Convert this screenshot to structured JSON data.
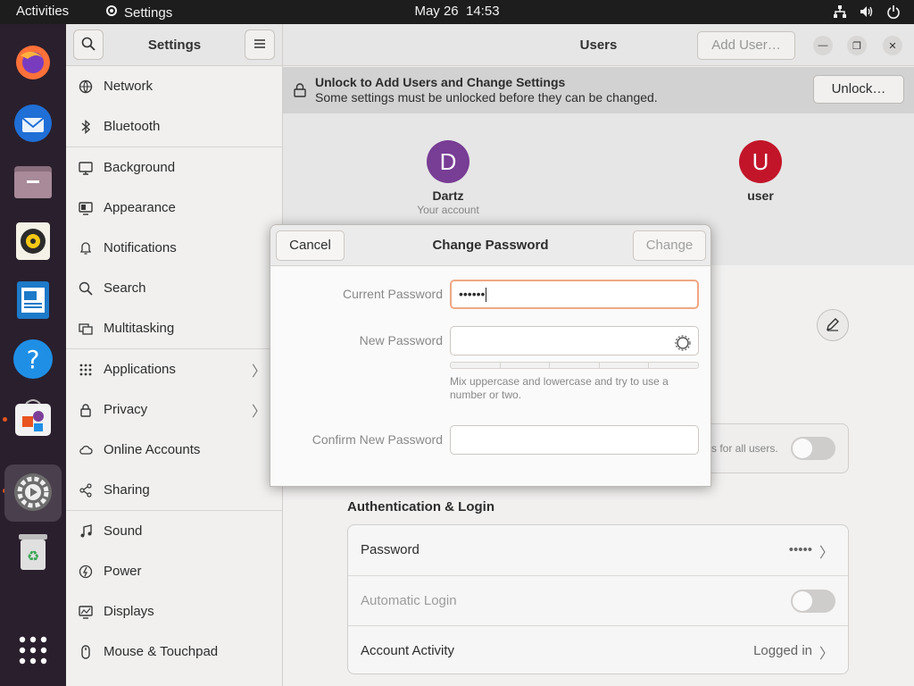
{
  "topbar": {
    "activities": "Activities",
    "app_name": "Settings",
    "date": "May 26",
    "time": "14:53",
    "tray_icons": [
      "network-icon",
      "volume-icon",
      "power-icon"
    ]
  },
  "dock": {
    "items": [
      {
        "name": "firefox",
        "icon": "firefox-icon"
      },
      {
        "name": "thunderbird",
        "icon": "thunderbird-icon"
      },
      {
        "name": "files",
        "icon": "files-icon"
      },
      {
        "name": "rhythmbox",
        "icon": "rhythmbox-icon"
      },
      {
        "name": "libreoffice-writer",
        "icon": "writer-icon"
      },
      {
        "name": "help",
        "icon": "help-icon"
      },
      {
        "name": "app-center",
        "icon": "app-center-icon"
      },
      {
        "name": "settings",
        "icon": "settings-icon"
      },
      {
        "name": "trash",
        "icon": "trash-icon"
      },
      {
        "name": "show-apps",
        "icon": "app-grid-icon"
      }
    ]
  },
  "sidebar": {
    "title": "Settings",
    "items": [
      {
        "label": "Network",
        "icon": "network-icon"
      },
      {
        "label": "Bluetooth",
        "icon": "bluetooth-icon"
      },
      {
        "label": "Background",
        "icon": "background-icon"
      },
      {
        "label": "Appearance",
        "icon": "appearance-icon"
      },
      {
        "label": "Notifications",
        "icon": "bell-icon"
      },
      {
        "label": "Search",
        "icon": "search-icon"
      },
      {
        "label": "Multitasking",
        "icon": "multitasking-icon"
      },
      {
        "label": "Applications",
        "icon": "apps-icon"
      },
      {
        "label": "Privacy",
        "icon": "lock-icon"
      },
      {
        "label": "Online Accounts",
        "icon": "cloud-icon"
      },
      {
        "label": "Sharing",
        "icon": "share-icon"
      },
      {
        "label": "Sound",
        "icon": "music-icon"
      },
      {
        "label": "Power",
        "icon": "power-icon"
      },
      {
        "label": "Displays",
        "icon": "display-icon"
      },
      {
        "label": "Mouse & Touchpad",
        "icon": "mouse-icon"
      }
    ]
  },
  "main": {
    "title": "Users",
    "add_user": "Add User…",
    "unlock_title": "Unlock to Add Users and Change Settings",
    "unlock_subtitle": "Some settings must be unlocked before they can be changed.",
    "unlock_button": "Unlock…",
    "users": [
      {
        "initial": "D",
        "name": "Dartz",
        "sub": "Your account",
        "color": "#7b3f98"
      },
      {
        "initial": "U",
        "name": "user",
        "sub": "",
        "color": "#c7162b"
      }
    ],
    "admin_fragment": "s for all users.",
    "auth_section": "Authentication & Login",
    "rows": {
      "password_label": "Password",
      "password_value": "•••••",
      "autologin_label": "Automatic Login",
      "activity_label": "Account Activity",
      "activity_value": "Logged in"
    }
  },
  "dialog": {
    "title": "Change Password",
    "cancel": "Cancel",
    "change": "Change",
    "current_label": "Current Password",
    "current_value": "••••••",
    "new_label": "New Password",
    "confirm_label": "Confirm New Password",
    "hint": "Mix uppercase and lowercase and try to use a number or two."
  },
  "colors": {
    "accent": "#e95420",
    "focus_border": "#f0a883"
  }
}
